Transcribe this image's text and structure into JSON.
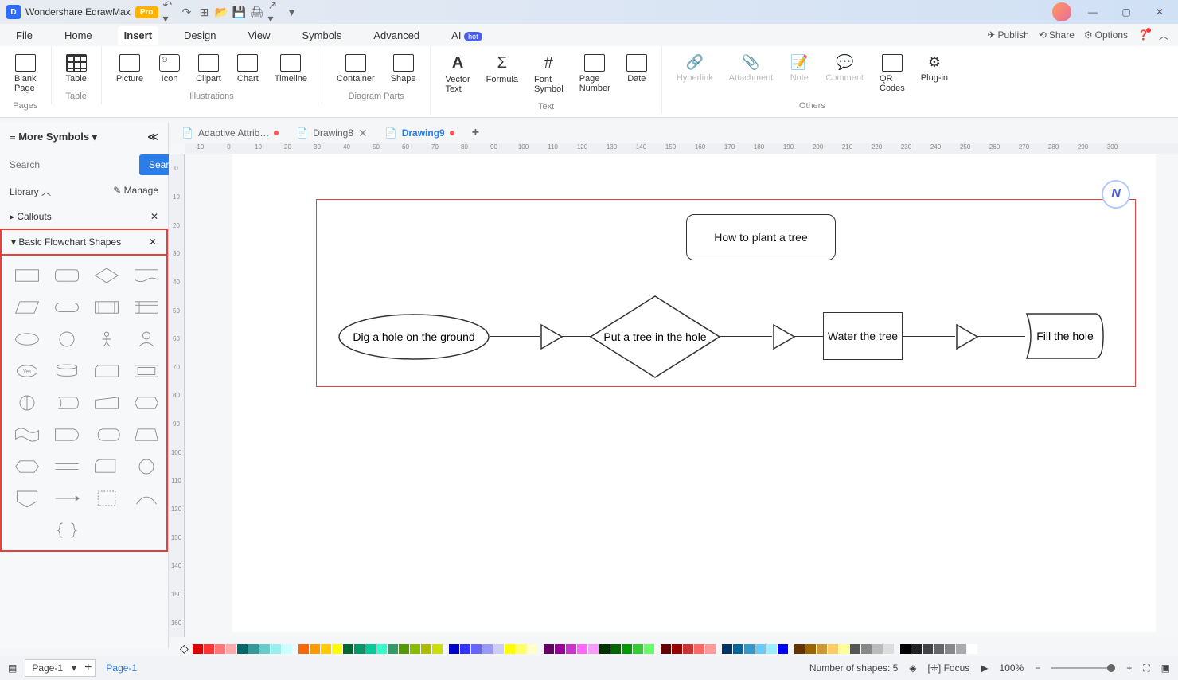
{
  "app": {
    "title": "Wondershare EdrawMax",
    "pro": "Pro"
  },
  "menus": {
    "file": "File",
    "home": "Home",
    "insert": "Insert",
    "design": "Design",
    "view": "View",
    "symbols": "Symbols",
    "advanced": "Advanced",
    "ai": "AI",
    "ai_badge": "hot"
  },
  "top_right": {
    "publish": "Publish",
    "share": "Share",
    "options": "Options"
  },
  "ribbon": {
    "blank_page": "Blank\nPage",
    "table": "Table",
    "picture": "Picture",
    "icon": "Icon",
    "clipart": "Clipart",
    "chart": "Chart",
    "timeline": "Timeline",
    "container": "Container",
    "shape": "Shape",
    "vector_text": "Vector\nText",
    "formula": "Formula",
    "font_symbol": "Font\nSymbol",
    "page_number": "Page\nNumber",
    "date": "Date",
    "hyperlink": "Hyperlink",
    "attachment": "Attachment",
    "note": "Note",
    "comment": "Comment",
    "qr": "QR\nCodes",
    "plugin": "Plug-in",
    "grp_pages": "Pages",
    "grp_table": "Table",
    "grp_illustrations": "Illustrations",
    "grp_diagram": "Diagram Parts",
    "grp_text": "Text",
    "grp_others": "Others"
  },
  "tabs": {
    "t1": "Adaptive Attrib…",
    "t2": "Drawing8",
    "t3": "Drawing9"
  },
  "panel": {
    "title": "More Symbols",
    "search_ph": "Search",
    "search_btn": "Search",
    "library": "Library",
    "manage": "Manage",
    "callouts": "Callouts",
    "basic": "Basic Flowchart Shapes"
  },
  "flowchart": {
    "title": "How to plant a tree",
    "step1": "Dig a hole on the ground",
    "step2": "Put a tree in the hole",
    "step3": "Water the tree",
    "step4": "Fill the hole"
  },
  "status": {
    "page_sel": "Page-1",
    "page_tab": "Page-1",
    "shapes": "Number of shapes: 5",
    "focus": "Focus",
    "zoom": "100%"
  },
  "ruler_h": [
    "-10",
    "0",
    "10",
    "20",
    "30",
    "40",
    "50",
    "60",
    "70",
    "80",
    "90",
    "100",
    "110",
    "120",
    "130",
    "140",
    "150",
    "160",
    "170",
    "180",
    "190",
    "200",
    "210",
    "220",
    "230",
    "240",
    "250",
    "260",
    "270",
    "280",
    "290",
    "300"
  ],
  "ruler_v": [
    "0",
    "10",
    "20",
    "30",
    "40",
    "50",
    "60",
    "70",
    "80",
    "90",
    "100",
    "110",
    "120",
    "130",
    "140",
    "150",
    "160"
  ],
  "colors": [
    "#d00",
    "#f33",
    "#f77",
    "#faa",
    "#066",
    "#399",
    "#6cc",
    "#9ee",
    "#cff",
    "",
    "#f60",
    "#f90",
    "#fc0",
    "#ff0",
    "#063",
    "#096",
    "#0c9",
    "#3fc",
    "#396",
    "#590",
    "#8b0",
    "#ab0",
    "#cd0",
    "",
    "#00c",
    "#33f",
    "#66f",
    "#99f",
    "#ccf",
    "#ff0",
    "#ff6",
    "#ffc",
    "",
    "#606",
    "#909",
    "#c3c",
    "#f6f",
    "#f9f",
    "#030",
    "#060",
    "#090",
    "#3c3",
    "#6f6",
    "",
    "#600",
    "#900",
    "#c33",
    "#f66",
    "#f99",
    "",
    "#036",
    "#069",
    "#39c",
    "#6cf",
    "#9ef",
    "#00f",
    "",
    "#630",
    "#960",
    "#c93",
    "#fc6",
    "#ff9",
    "#555",
    "#888",
    "#bbb",
    "#ddd",
    "",
    "#000",
    "#222",
    "#444",
    "#666",
    "#888",
    "#aaa",
    "#fff"
  ]
}
